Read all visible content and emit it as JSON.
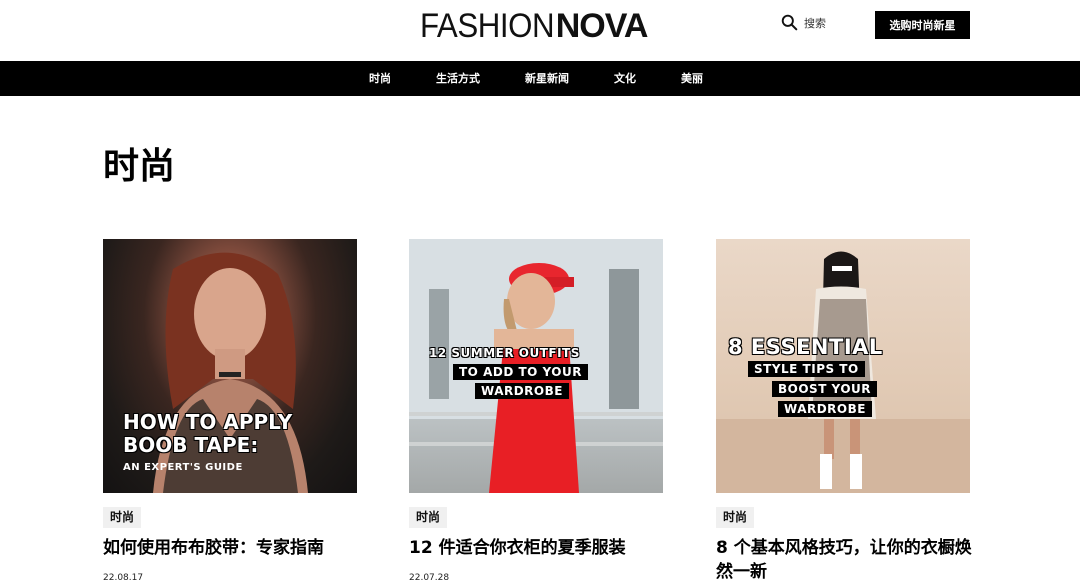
{
  "header": {
    "logo_light": "FASHION",
    "logo_bold": "NOVA",
    "search_label": "搜索",
    "shop_button": "选购时尚新星"
  },
  "nav": {
    "items": [
      "时尚",
      "生活方式",
      "新星新闻",
      "文化",
      "美丽"
    ]
  },
  "page": {
    "title": "时尚"
  },
  "articles": [
    {
      "tag": "时尚",
      "title": "如何使用布布胶带：专家指南",
      "date": "22.08.17",
      "image_text": [
        "HOW TO APPLY",
        "BOOB TAPE:",
        "AN EXPERT'S GUIDE"
      ]
    },
    {
      "tag": "时尚",
      "title": "12 件适合你衣柜的夏季服装",
      "date": "22.07.28",
      "image_text": [
        "12 SUMMER OUTFITS",
        "TO ADD TO YOUR",
        "WARDROBE"
      ]
    },
    {
      "tag": "时尚",
      "title": "8 个基本风格技巧，让你的衣橱焕然一新",
      "date": "",
      "image_text": [
        "8 ESSENTIAL",
        "STYLE TIPS TO",
        "BOOST YOUR",
        "WARDROBE"
      ]
    }
  ],
  "colors": {
    "nav_bg": "#000000",
    "button_bg": "#000000",
    "tag_bg": "#f0f0f0"
  }
}
